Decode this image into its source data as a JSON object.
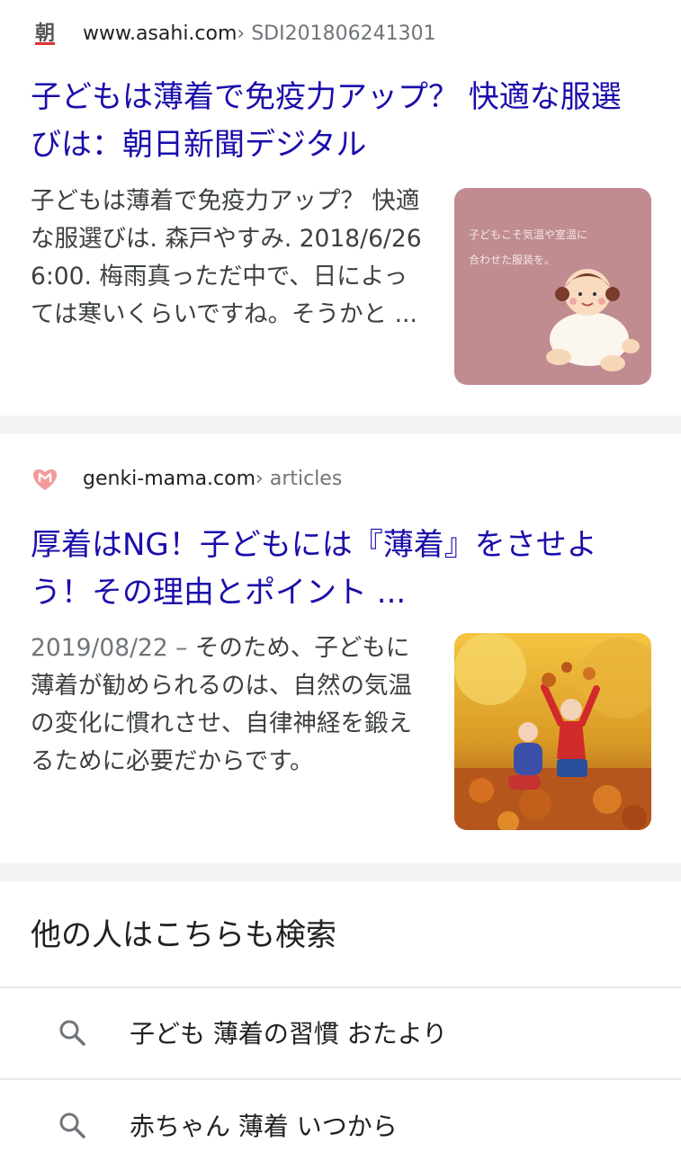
{
  "results": [
    {
      "domain": "www.asahi.com",
      "path": " › SDI201806241301",
      "favicon_icon": "asahi-logo-icon",
      "favicon_char": "朝",
      "title": "子どもは薄着で免疫力アップ？ 快適な服選びは：朝日新聞デジタル",
      "date": "",
      "snippet": "子どもは薄着で免疫力アップ？ 快適な服選びは. 森戸やすみ. 2018/6/26 6:00. 梅雨真っただ中で、日によっては寒いくらいですね。そうかと ...",
      "thumbnail_caption_1": "子どもこそ気温や室温に",
      "thumbnail_caption_2": "合わせた服装を。",
      "thumbnail_bg": "#c08c90"
    },
    {
      "domain": "genki-mama.com",
      "path": " › articles",
      "favicon_icon": "heart-m-logo-icon",
      "title": "厚着はNG！子どもには『薄着』をさせよう！その理由とポイント ...",
      "date": "2019/08/22 – ",
      "snippet": "そのため、子どもに薄着が勧められるのは、自然の気温の変化に慣れさせ、自律神経を鍛えるために必要だからです。",
      "thumbnail_icon": "children-autumn-leaves-photo"
    }
  ],
  "people_also_search": {
    "title": "他の人はこちらも検索",
    "items": [
      {
        "label": "子ども 薄着の習慣 おたより",
        "icon": "search-icon"
      },
      {
        "label": "赤ちゃん 薄着 いつから",
        "icon": "search-icon"
      }
    ]
  },
  "colors": {
    "link": "#1a0dab",
    "separator": "#f1f3f4",
    "snippet": "#3c4043",
    "muted": "#70757a"
  }
}
